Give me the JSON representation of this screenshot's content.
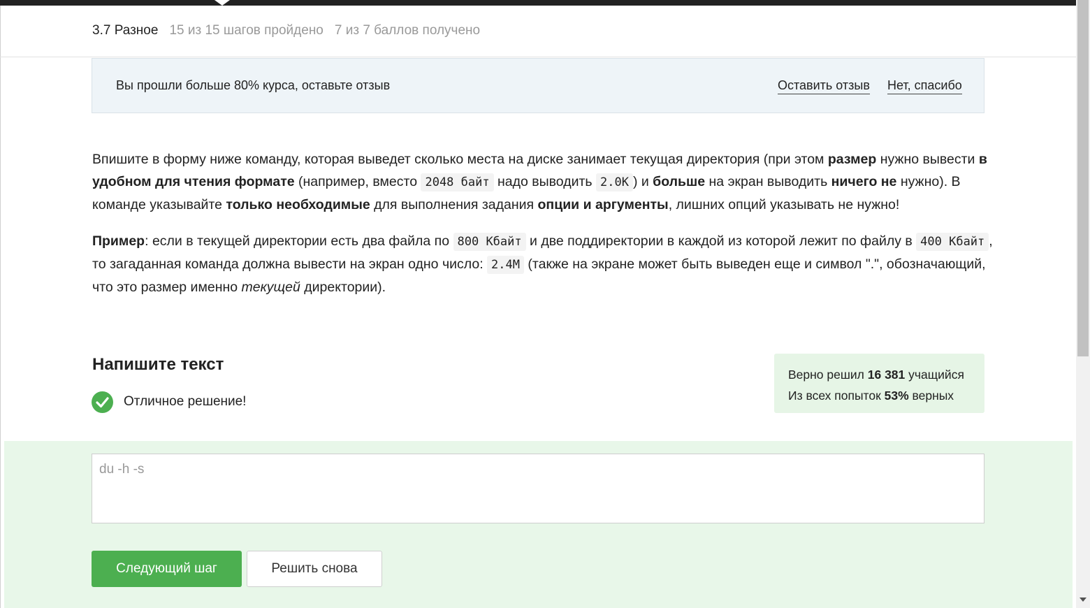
{
  "header": {
    "lesson": "3.7 Разное",
    "steps_progress": "15 из 15 шагов пройдено",
    "points_progress": "7 из 7 баллов  получено"
  },
  "review_banner": {
    "message": "Вы прошли больше 80% курса, оставьте отзыв",
    "leave_review": "Оставить отзыв",
    "no_thanks": "Нет, спасибо"
  },
  "task": {
    "p1": [
      {
        "t": "Впишите в форму ниже команду, которая выведет сколько места на диске занимает текущая директория (при этом "
      },
      {
        "b": "размер"
      },
      {
        "t": " нужно вывести "
      },
      {
        "b": "в удобном для чтения формате"
      },
      {
        "t": " (например, вместо "
      },
      {
        "c": "2048 байт"
      },
      {
        "t": " надо выводить "
      },
      {
        "c": "2.0K"
      },
      {
        "t": ") и "
      },
      {
        "b": "больше"
      },
      {
        "t": " на экран выводить "
      },
      {
        "b": "ничего не"
      },
      {
        "t": " нужно). В команде указывайте "
      },
      {
        "b": "только необходимые"
      },
      {
        "t": " для выполнения задания "
      },
      {
        "b": "опции и аргументы"
      },
      {
        "t": ", лишних опций указывать не нужно!"
      }
    ],
    "p2": [
      {
        "b": "Пример"
      },
      {
        "t": ": если в текущей директории есть два файла по "
      },
      {
        "c": "800 Кбайт"
      },
      {
        "t": " и две поддиректории в каждой из которой лежит по файлу в "
      },
      {
        "c": "400 Кбайт"
      },
      {
        "t": ", то загаданная команда должна вывести на экран одно число: "
      },
      {
        "c": "2.4M"
      },
      {
        "t": " (также на экране может быть выведен еще и символ \".\", обозначающий, что это размер именно "
      },
      {
        "i": "текущей"
      },
      {
        "t": " директории)."
      }
    ]
  },
  "quiz": {
    "title": "Напишите текст",
    "feedback": "Отличное решение!",
    "stats_line1_pre": "Верно решил ",
    "stats_line1_num": "16 381",
    "stats_line1_post": " учащийся",
    "stats_line2_pre": "Из всех попыток ",
    "stats_line2_num": "53%",
    "stats_line2_post": " верных",
    "answer_value": "du -h -s",
    "next_button": "Следующий шаг",
    "retry_button": "Решить снова"
  },
  "colors": {
    "accent_green": "#4caf50",
    "answer_bg": "#e8f7e9",
    "banner_bg": "#eef4f8",
    "topbar": "#222222"
  },
  "icons": [
    "check-circle-icon",
    "scroll-down-arrow-icon"
  ]
}
